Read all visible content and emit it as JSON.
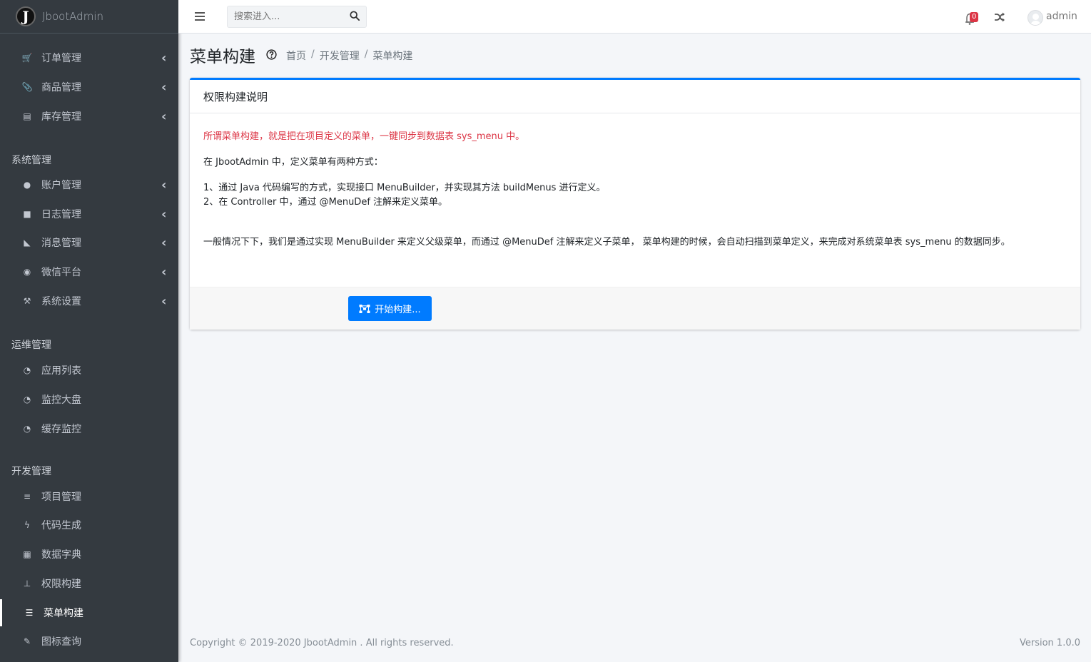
{
  "brand": {
    "logo": "J",
    "name": "JbootAdmin"
  },
  "sidebar": {
    "items": [
      {
        "label": "订单管理",
        "icon": "cart-icon",
        "glyph": "🛒",
        "chevron": true
      },
      {
        "label": "商品管理",
        "icon": "paperclip-icon",
        "glyph": "📎",
        "chevron": true
      },
      {
        "label": "库存管理",
        "icon": "warehouse-icon",
        "glyph": "▤",
        "chevron": true
      },
      {
        "label": "账户管理",
        "icon": "user-icon",
        "glyph": "●",
        "chevron": true
      },
      {
        "label": "日志管理",
        "icon": "book-icon",
        "glyph": "■",
        "chevron": true
      },
      {
        "label": "消息管理",
        "icon": "bullhorn-icon",
        "glyph": "◣",
        "chevron": true
      },
      {
        "label": "微信平台",
        "icon": "wechat-icon",
        "glyph": "◉",
        "chevron": true
      },
      {
        "label": "系统设置",
        "icon": "hammer-icon",
        "glyph": "⚒",
        "chevron": true
      },
      {
        "label": "应用列表",
        "icon": "dashboard-icon",
        "glyph": "◔",
        "chevron": false
      },
      {
        "label": "监控大盘",
        "icon": "dashboard-icon",
        "glyph": "◔",
        "chevron": false
      },
      {
        "label": "缓存监控",
        "icon": "dashboard-icon",
        "glyph": "◔",
        "chevron": false
      },
      {
        "label": "项目管理",
        "icon": "database-icon",
        "glyph": "≡",
        "chevron": false
      },
      {
        "label": "代码生成",
        "icon": "bolt-icon",
        "glyph": "ϟ",
        "chevron": false
      },
      {
        "label": "数据字典",
        "icon": "grid-icon",
        "glyph": "▦",
        "chevron": false
      },
      {
        "label": "权限构建",
        "icon": "sitemap-icon",
        "glyph": "⊥",
        "chevron": false
      },
      {
        "label": "菜单构建",
        "icon": "list-icon",
        "glyph": "☰",
        "chevron": false
      },
      {
        "label": "图标查询",
        "icon": "pen-icon",
        "glyph": "✎",
        "chevron": false
      }
    ],
    "headers": [
      "系统管理",
      "运维管理",
      "开发管理"
    ]
  },
  "topbar": {
    "search_placeholder": "搜索进入...",
    "notification_count": "0",
    "username": "admin"
  },
  "page": {
    "title": "菜单构建",
    "breadcrumb": [
      "首页",
      "开发管理",
      "菜单构建"
    ]
  },
  "card": {
    "header": "权限构建说明",
    "line1": "所谓菜单构建，就是把在项目定义的菜单，一键同步到数据表 sys_menu 中。",
    "line2": "在 JbootAdmin 中，定义菜单有两种方式：",
    "line3": "1、通过 Java 代码编写的方式，实现接口 MenuBuilder，并实现其方法 buildMenus 进行定义。",
    "line4": "2、在 Controller 中，通过 @MenuDef 注解来定义菜单。",
    "line5": "一般情况下下，我们是通过实现 MenuBuilder 来定义父级菜单，而通过 @MenuDef 注解来定义子菜单， 菜单构建的时候，会自动扫描到菜单定义，来完成对系统菜单表 sys_menu 的数据同步。",
    "button_label": "开始构建..."
  },
  "footer": {
    "copyright": "Copyright © 2019-2020 JbootAdmin . All rights reserved.",
    "version": "Version 1.0.0"
  },
  "colors": {
    "sidebar_bg": "#343a40",
    "primary": "#007bff",
    "danger": "#dc3545"
  }
}
